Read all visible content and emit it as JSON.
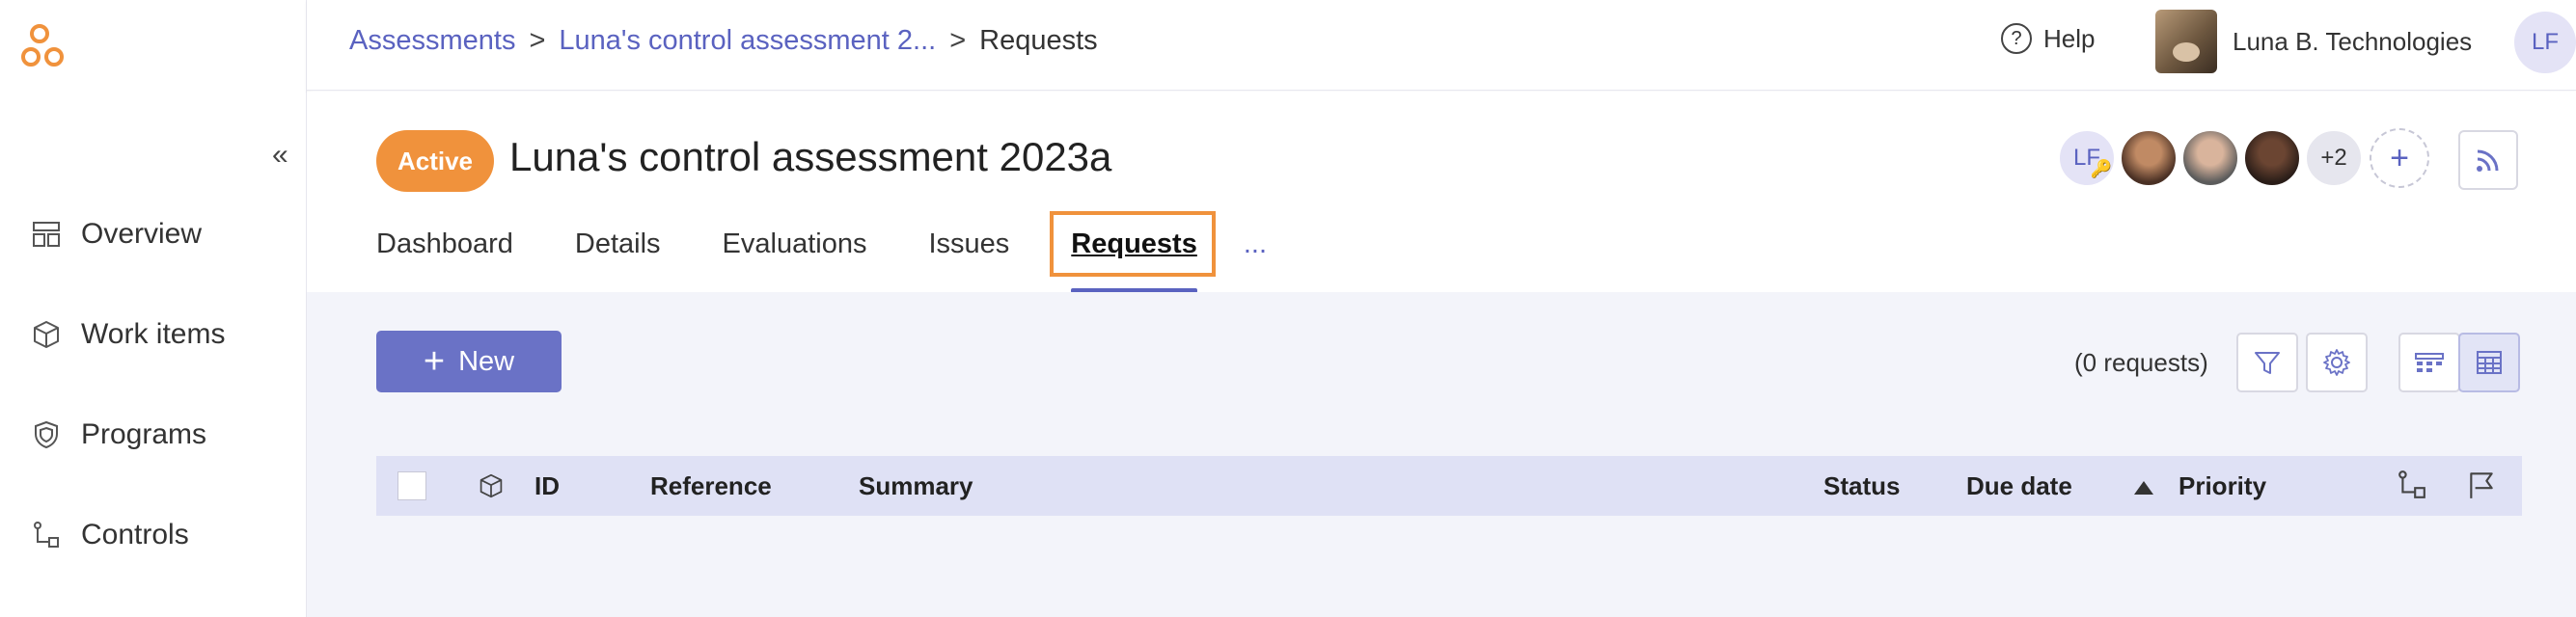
{
  "breadcrumb": {
    "items": [
      "Assessments",
      "Luna's control assessment 2...",
      "Requests"
    ],
    "separator": ">"
  },
  "topbar": {
    "help_label": "Help",
    "org_name": "Luna B. Technologies",
    "user_initials": "LF"
  },
  "sidebar": {
    "collapse_icon": "«",
    "items": [
      {
        "label": "Overview",
        "icon": "overview-icon"
      },
      {
        "label": "Work items",
        "icon": "cube-icon"
      },
      {
        "label": "Programs",
        "icon": "shield-icon"
      },
      {
        "label": "Controls",
        "icon": "controls-icon"
      }
    ]
  },
  "header": {
    "status_badge": "Active",
    "title": "Luna's control assessment 2023a",
    "avatars": {
      "owner_initials": "LF",
      "more_count": "+2",
      "add_symbol": "+"
    },
    "tabs": [
      "Dashboard",
      "Details",
      "Evaluations",
      "Issues",
      "Requests",
      "..."
    ],
    "active_tab": "Requests"
  },
  "toolbar": {
    "new_label": "New",
    "count_text": "(0 requests)"
  },
  "table": {
    "columns": [
      "ID",
      "Reference",
      "Summary",
      "Status",
      "Due date",
      "Priority"
    ]
  },
  "colors": {
    "accent": "#5a62c0",
    "primary_button": "#6a72c6",
    "active_badge": "#f0923c",
    "table_header": "#dfe1f5"
  }
}
